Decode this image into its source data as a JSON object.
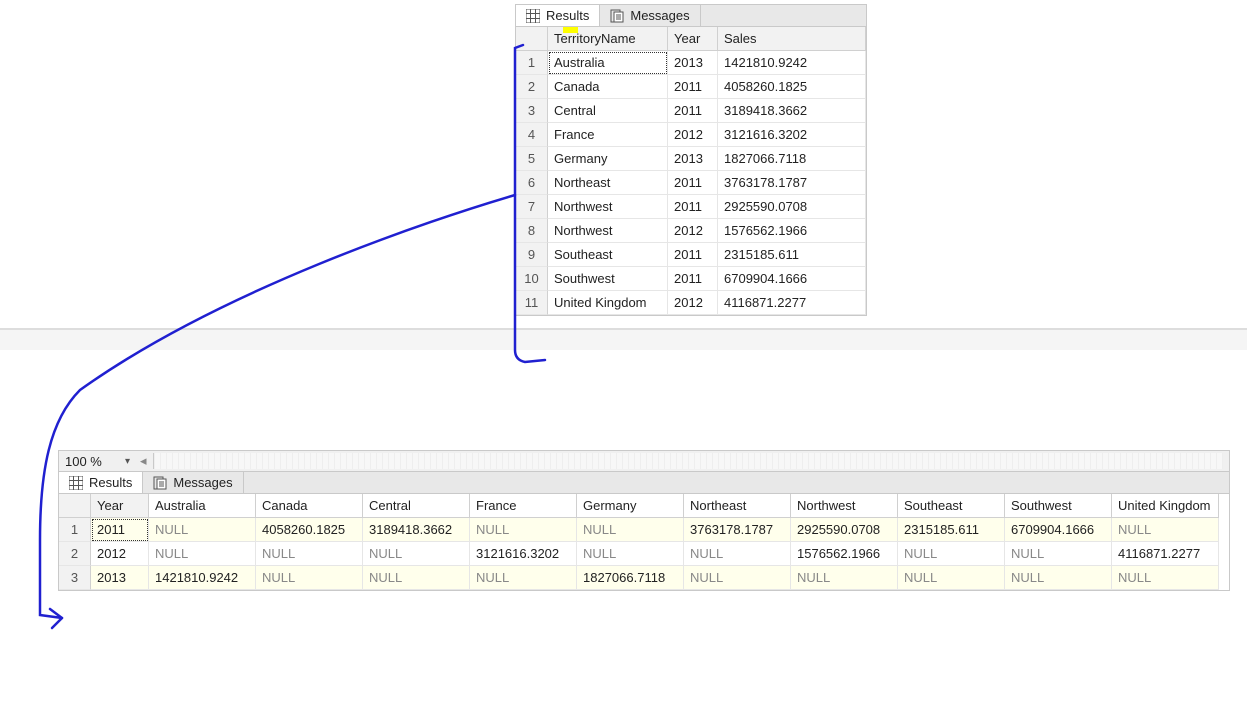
{
  "top": {
    "tabs": {
      "results": "Results",
      "messages": "Messages"
    },
    "columns": [
      "TerritoryName",
      "Year",
      "Sales"
    ],
    "rows": [
      {
        "territory": "Australia",
        "year": "2013",
        "sales": "1421810.9242"
      },
      {
        "territory": "Canada",
        "year": "2011",
        "sales": "4058260.1825"
      },
      {
        "territory": "Central",
        "year": "2011",
        "sales": "3189418.3662"
      },
      {
        "territory": "France",
        "year": "2012",
        "sales": "3121616.3202"
      },
      {
        "territory": "Germany",
        "year": "2013",
        "sales": "1827066.7118"
      },
      {
        "territory": "Northeast",
        "year": "2011",
        "sales": "3763178.1787"
      },
      {
        "territory": "Northwest",
        "year": "2011",
        "sales": "2925590.0708"
      },
      {
        "territory": "Northwest",
        "year": "2012",
        "sales": "1576562.1966"
      },
      {
        "territory": "Southeast",
        "year": "2011",
        "sales": "2315185.611"
      },
      {
        "territory": "Southwest",
        "year": "2011",
        "sales": "6709904.1666"
      },
      {
        "territory": "United Kingdom",
        "year": "2012",
        "sales": "4116871.2277"
      }
    ]
  },
  "bottom": {
    "zoom": "100 %",
    "tabs": {
      "results": "Results",
      "messages": "Messages"
    },
    "null_text": "NULL",
    "columns": [
      "Year",
      "Australia",
      "Canada",
      "Central",
      "France",
      "Germany",
      "Northeast",
      "Northwest",
      "Southeast",
      "Southwest",
      "United Kingdom"
    ],
    "rows": [
      {
        "year": "2011",
        "values": [
          null,
          "4058260.1825",
          "3189418.3662",
          null,
          null,
          "3763178.1787",
          "2925590.0708",
          "2315185.611",
          "6709904.1666",
          null
        ]
      },
      {
        "year": "2012",
        "values": [
          null,
          null,
          null,
          "3121616.3202",
          null,
          null,
          "1576562.1966",
          null,
          null,
          "4116871.2277"
        ]
      },
      {
        "year": "2013",
        "values": [
          "1421810.9242",
          null,
          null,
          null,
          "1827066.7118",
          null,
          null,
          null,
          null,
          null
        ]
      }
    ]
  }
}
